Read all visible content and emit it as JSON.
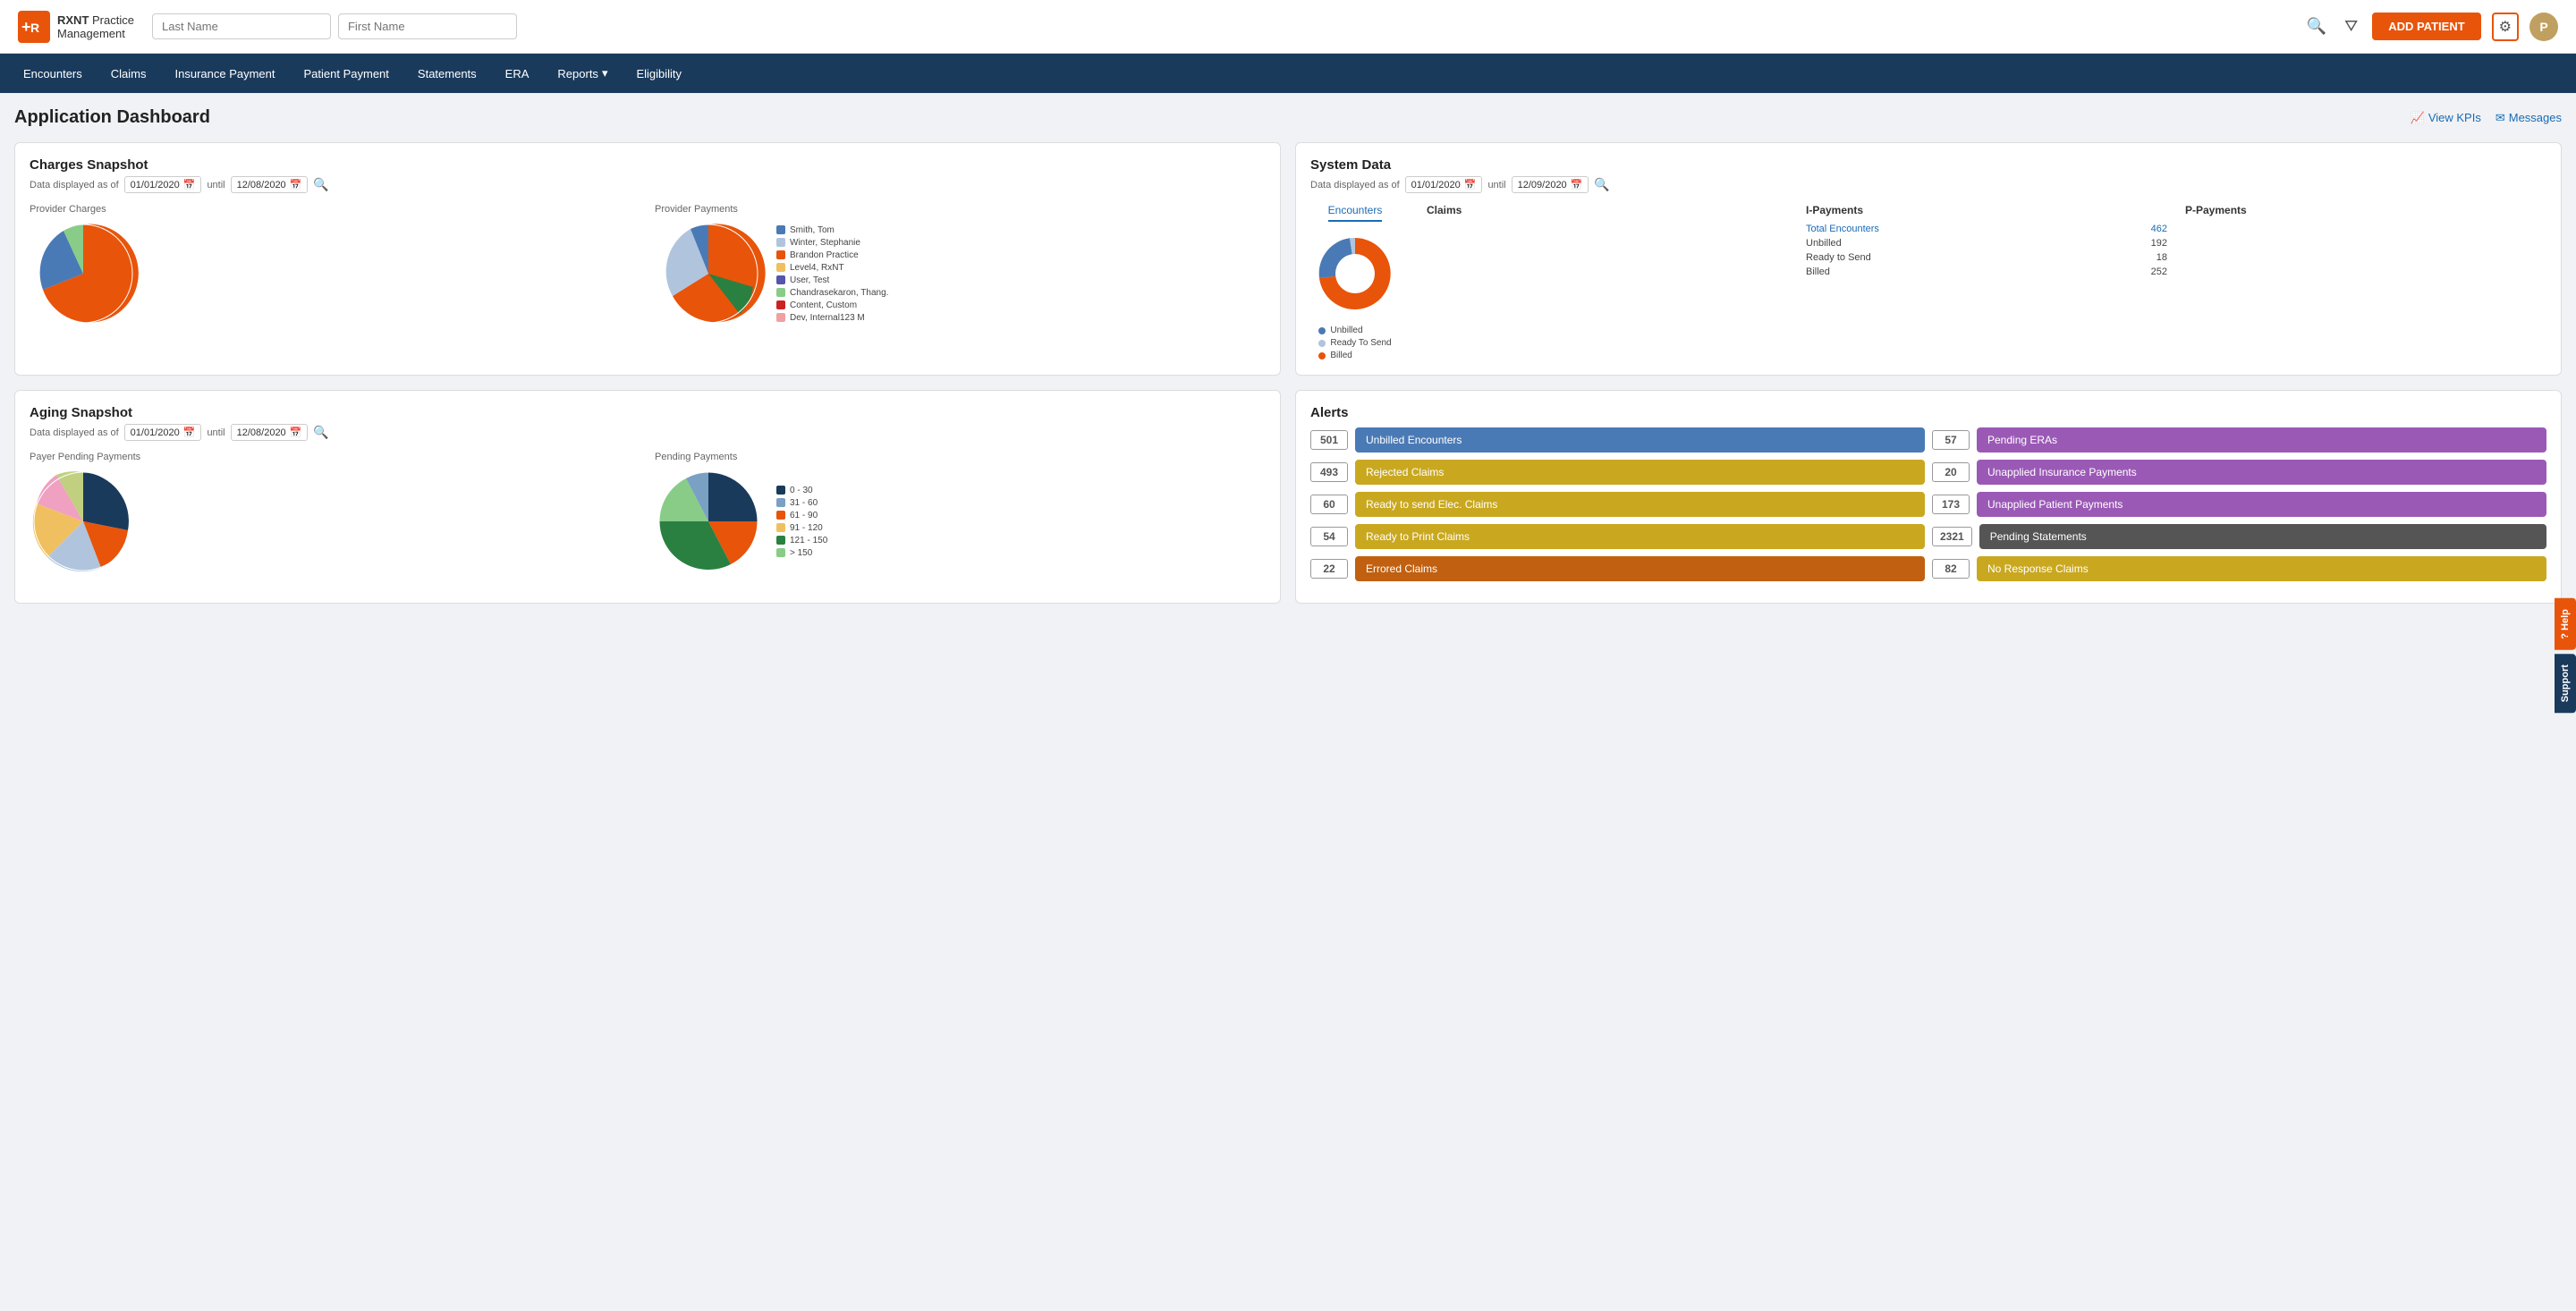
{
  "header": {
    "logo_text_line1": "Practice",
    "logo_text_line2": "Management",
    "search_lastname_placeholder": "Last Name",
    "search_firstname_placeholder": "First Name",
    "add_patient_label": "ADD PATIENT"
  },
  "nav": {
    "items": [
      {
        "label": "Encounters",
        "active": false
      },
      {
        "label": "Claims",
        "active": false
      },
      {
        "label": "Insurance Payment",
        "active": false
      },
      {
        "label": "Patient Payment",
        "active": false
      },
      {
        "label": "Statements",
        "active": false
      },
      {
        "label": "ERA",
        "active": false
      },
      {
        "label": "Reports",
        "active": false
      },
      {
        "label": "Eligibility",
        "active": false
      }
    ]
  },
  "page": {
    "title": "Application Dashboard",
    "view_kpis_label": "View KPIs",
    "messages_label": "Messages"
  },
  "charges_snapshot": {
    "title": "Charges Snapshot",
    "subtitle_prefix": "Data displayed as of",
    "date_from": "01/01/2020",
    "date_to": "12/08/2020",
    "provider_charges_label": "Provider Charges",
    "provider_payments_label": "Provider Payments",
    "legend": [
      {
        "label": "Smith, Tom",
        "color": "#4a7ab5"
      },
      {
        "label": "Winter, Stephanie",
        "color": "#b0c4de"
      },
      {
        "label": "Brandon Practice",
        "color": "#e8540a"
      },
      {
        "label": "Level4, RxNT",
        "color": "#f0c060"
      },
      {
        "label": "User, Test",
        "color": "#5555aa"
      },
      {
        "label": "Chandrasekaron, Thang.",
        "color": "#88cc88"
      },
      {
        "label": "Content, Custom",
        "color": "#cc2222"
      },
      {
        "label": "Dev, Internal123 M",
        "color": "#f0a0a0"
      }
    ]
  },
  "system_data": {
    "title": "System Data",
    "subtitle_prefix": "Data displayed as of",
    "date_from": "01/01/2020",
    "date_to": "12/09/2020",
    "tabs": [
      "Encounters",
      "Claims",
      "I-Payments",
      "P-Payments"
    ],
    "encounters_label": "Encounters",
    "claims_label": "Claims",
    "i_payments_label": "I-Payments",
    "p_payments_label": "P-Payments",
    "total_encounters_label": "Total Encounters",
    "total_encounters_val": "462",
    "unbilled_label": "Unbilled",
    "unbilled_val": "192",
    "ready_to_send_label": "Ready to Send",
    "ready_to_send_val": "18",
    "billed_label": "Billed",
    "billed_val": "252",
    "donut_legend": [
      {
        "label": "Unbilled",
        "color": "#4a7ab5"
      },
      {
        "label": "Ready To Send",
        "color": "#b0c4de"
      },
      {
        "label": "Billed",
        "color": "#e8540a"
      }
    ]
  },
  "aging_snapshot": {
    "title": "Aging Snapshot",
    "subtitle_prefix": "Data displayed as of",
    "date_from": "01/01/2020",
    "date_to": "12/08/2020",
    "payer_pending_label": "Payer Pending Payments",
    "pending_payments_label": "Pending Payments",
    "legend": [
      {
        "label": "0 - 30",
        "color": "#1a3a5c"
      },
      {
        "label": "31 - 60",
        "color": "#7aa0c4"
      },
      {
        "label": "61 - 90",
        "color": "#e8540a"
      },
      {
        "label": "91 - 120",
        "color": "#f0c060"
      },
      {
        "label": "121 - 150",
        "color": "#2a8040"
      },
      {
        "label": "> 150",
        "color": "#88cc88"
      }
    ]
  },
  "alerts": {
    "title": "Alerts",
    "items_left": [
      {
        "count": "501",
        "label": "Unbilled Encounters",
        "color": "alert-blue"
      },
      {
        "count": "493",
        "label": "Rejected Claims",
        "color": "alert-yellow"
      },
      {
        "count": "60",
        "label": "Ready to send Elec. Claims",
        "color": "alert-yellow"
      },
      {
        "count": "54",
        "label": "Ready to Print Claims",
        "color": "alert-yellow"
      },
      {
        "count": "22",
        "label": "Errored Claims",
        "color": "alert-orange"
      }
    ],
    "items_right": [
      {
        "count": "57",
        "label": "Pending ERAs",
        "color": "alert-purple"
      },
      {
        "count": "20",
        "label": "Unapplied Insurance Payments",
        "color": "alert-purple"
      },
      {
        "count": "173",
        "label": "Unapplied Patient Payments",
        "color": "alert-purple"
      },
      {
        "count": "2321",
        "label": "Pending Statements",
        "color": "alert-gray"
      },
      {
        "count": "82",
        "label": "No Response Claims",
        "color": "alert-yellow"
      }
    ]
  },
  "side_tabs": {
    "help_label": "? Help",
    "support_label": "Support"
  }
}
